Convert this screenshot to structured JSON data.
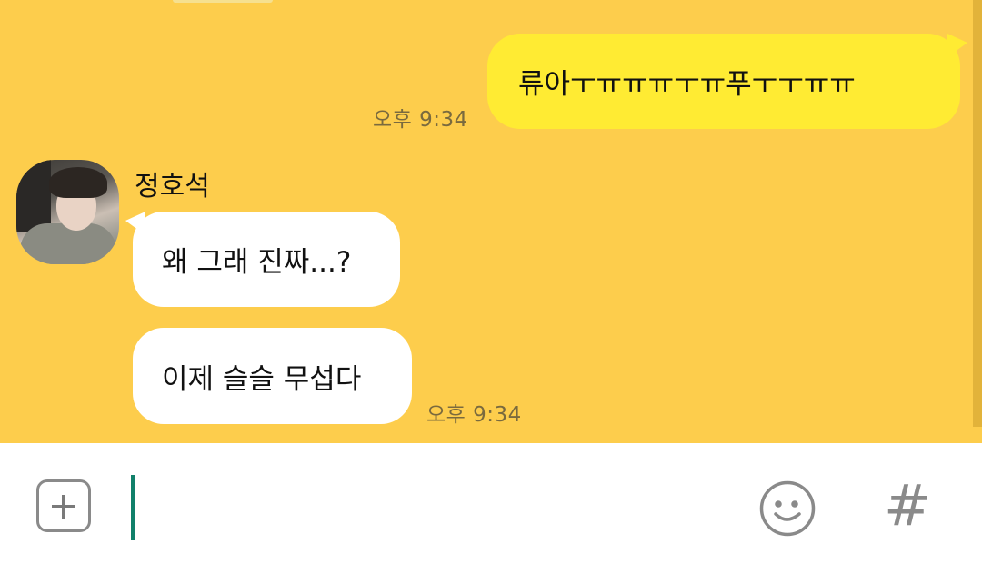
{
  "colors": {
    "chat_background": "#fdcd4c",
    "outgoing_bubble": "#ffeb33",
    "incoming_bubble": "#ffffff",
    "cursor": "#11806a"
  },
  "messages": {
    "outgoing": {
      "text": "류아ㅜㅠㅠㅠㅜㅠ푸ㅜㅜㅠㅠ",
      "time": "오후 9:34"
    },
    "incoming": {
      "sender": "정호석",
      "bubbles": [
        {
          "text": "왜 그래 진짜...?"
        },
        {
          "text": "이제 슬슬 무섭다"
        }
      ],
      "time": "오후 9:34"
    }
  },
  "input_bar": {
    "plus_icon": "plus-icon",
    "emoji_icon": "smiley-icon",
    "hash_label": "#"
  }
}
